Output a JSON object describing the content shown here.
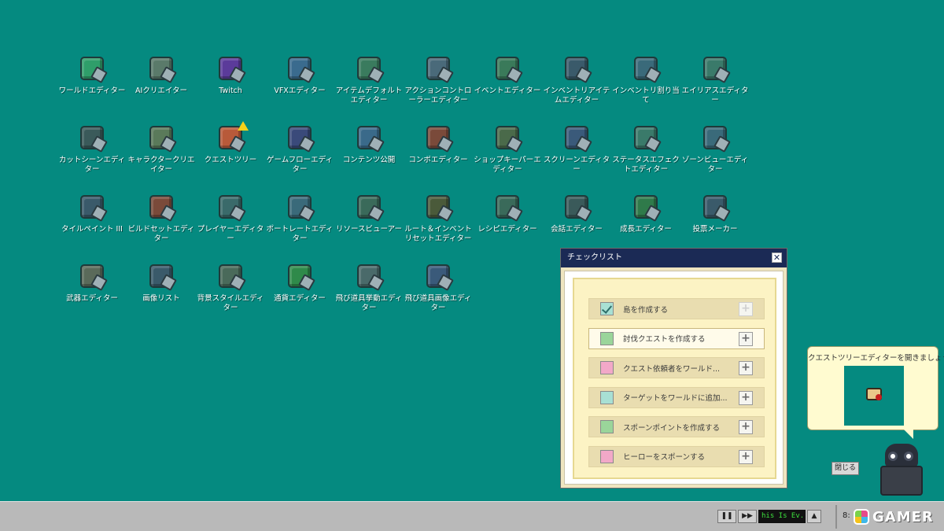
{
  "desktop": {
    "icons": [
      {
        "label": "ワールドエディター",
        "color": "#2f9e6a"
      },
      {
        "label": "AIクリエイター",
        "color": "#5a7a6a"
      },
      {
        "label": "Twitch",
        "color": "#5b3b9a"
      },
      {
        "label": "VFXエディター",
        "color": "#3a6b8e"
      },
      {
        "label": "アイテムデフォルトエディター",
        "color": "#3a7b5e"
      },
      {
        "label": "アクションコントローラーエディター",
        "color": "#4a6a7a"
      },
      {
        "label": "イベントエディター",
        "color": "#3a7a5a"
      },
      {
        "label": "インベントリアイテムエディター",
        "color": "#3a5a6a"
      },
      {
        "label": "インベントリ割り当て",
        "color": "#3a6a7a"
      },
      {
        "label": "エイリアスエディター",
        "color": "#3a7a6a"
      },
      {
        "label": "カットシーンエディター",
        "color": "#3a5a5a"
      },
      {
        "label": "キャラクタークリエイター",
        "color": "#5a7a5a"
      },
      {
        "label": "クエストツリー",
        "color": "#b85a3a",
        "warning": true
      },
      {
        "label": "ゲームフローエディター",
        "color": "#3a4a7a"
      },
      {
        "label": "コンテンツ公開",
        "color": "#3a6a8a"
      },
      {
        "label": "コンボエディター",
        "color": "#7a4a3a"
      },
      {
        "label": "ショップキーパーエディター",
        "color": "#4a6a4a"
      },
      {
        "label": "スクリーンエディター",
        "color": "#3a5a7a"
      },
      {
        "label": "ステータスエフェクトエディター",
        "color": "#3a7a6a"
      },
      {
        "label": "ゾーンビューエディター",
        "color": "#3a6a7a"
      },
      {
        "label": "タイルペイント III",
        "color": "#3a5a6a"
      },
      {
        "label": "ビルドセットエディター",
        "color": "#7a4a3a"
      },
      {
        "label": "プレイヤーエディター",
        "color": "#3a6a6a"
      },
      {
        "label": "ポートレートエディター",
        "color": "#3a6a7a"
      },
      {
        "label": "リソースビューアー",
        "color": "#3a6a5a"
      },
      {
        "label": "ルート＆インベントリセットエディター",
        "color": "#4a5a3a"
      },
      {
        "label": "レシピエディター",
        "color": "#3a6a5a"
      },
      {
        "label": "会話エディター",
        "color": "#3a5a5a"
      },
      {
        "label": "成長エディター",
        "color": "#2f7a4a"
      },
      {
        "label": "投票メーカー",
        "color": "#3a5a6a"
      },
      {
        "label": "武器エディター",
        "color": "#5a6a5a"
      },
      {
        "label": "画像リスト",
        "color": "#3a5a6a"
      },
      {
        "label": "背景スタイルエディター",
        "color": "#4a6a5a"
      },
      {
        "label": "通貨エディター",
        "color": "#2f8a4a"
      },
      {
        "label": "飛び道具挙動エディター",
        "color": "#4a6a6a"
      },
      {
        "label": "飛び道具画像エディター",
        "color": "#3a5a7a"
      }
    ]
  },
  "checklist": {
    "title": "チェックリスト",
    "close_glyph": "✕",
    "tasks": [
      {
        "text": "島を作成する",
        "box_color": "#a8e0d4",
        "checked": true,
        "active": false
      },
      {
        "text": "討伐クエストを作成する",
        "box_color": "#9ad59a",
        "checked": false,
        "active": true
      },
      {
        "text": "クエスト依頼者をワールド...",
        "box_color": "#f2a8c8",
        "checked": false,
        "active": false
      },
      {
        "text": "ターゲットをワールドに追加...",
        "box_color": "#a8e0d4",
        "checked": false,
        "active": false
      },
      {
        "text": "スポーンポイントを作成する",
        "box_color": "#9ad59a",
        "checked": false,
        "active": false
      },
      {
        "text": "ヒーローをスポーンする",
        "box_color": "#f2a8c8",
        "checked": false,
        "active": false
      }
    ],
    "plus_glyph": "+"
  },
  "hint": {
    "text": "クエストツリーエディターを開きましょう",
    "close_label": "閉じる"
  },
  "taskbar": {
    "pause_glyph": "❚❚",
    "next_glyph": "▶▶",
    "ticker_text": "his Is Ev...",
    "up_glyph": "▲",
    "clock": "8:",
    "logo_text": "GAMER"
  }
}
